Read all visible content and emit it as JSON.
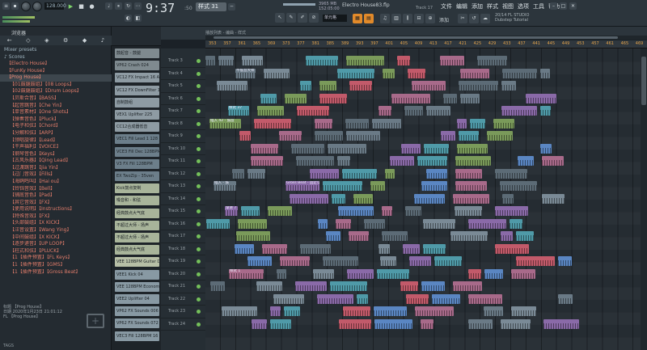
{
  "toolbar": {
    "bpm": "128.000",
    "time": "9:37",
    "time_sub": ":50",
    "pattern": "样式 31",
    "cpu": "3965 MB",
    "mem": "152:05:00",
    "song_title": "Electro House83.flp",
    "track_hint": "Track 17",
    "snap": "单元格",
    "add_label": "添加",
    "studio_line1": "20/14 FL STUDIO",
    "studio_line2": "Dubstep Tutorial"
  },
  "menu": [
    "文件",
    "编辑",
    "添加",
    "样式",
    "视图",
    "选项",
    "工具",
    "帮助"
  ],
  "browser": {
    "title": "浏览器",
    "tabs": [
      "←",
      "◇",
      "◈",
      "⚙",
      "◆",
      "♪"
    ],
    "items": [
      {
        "label": "Mixer presets",
        "kind": "plain"
      },
      {
        "label": "♪ Scores",
        "kind": "plain"
      },
      {
        "label": "【Electro House】",
        "kind": "normal"
      },
      {
        "label": "【FunKy House】",
        "kind": "normal"
      },
      {
        "label": "【Prog House】",
        "kind": "sel"
      },
      {
        "label": "【01鼓腿鼓组】【08 Loops】",
        "kind": "normal"
      },
      {
        "label": "【02鼓腿鼓组】【Drum Loops】",
        "kind": "normal"
      },
      {
        "label": "【贝斯合音】【BASS】",
        "kind": "normal"
      },
      {
        "label": "【起音跳音】【Che Yin】",
        "kind": "normal"
      },
      {
        "label": "【单音素材】【One Shots】",
        "kind": "normal"
      },
      {
        "label": "【弹奏音色】【Pluck】",
        "kind": "normal"
      },
      {
        "label": "【电子和弦】【Chord】",
        "kind": "normal"
      },
      {
        "label": "【分解和弦】【ARP】",
        "kind": "normal"
      },
      {
        "label": "【领唱旋律】【Lead】",
        "kind": "normal"
      },
      {
        "label": "【干声福利】【VOICE】",
        "kind": "normal"
      },
      {
        "label": "【钢琴音色】【Keys】",
        "kind": "normal"
      },
      {
        "label": "【古风乐器】【Qing Lead】",
        "kind": "normal"
      },
      {
        "label": "【过渡跳音】【Jia Yin】",
        "kind": "normal"
      },
      {
        "label": "【过门音效】【Fills】",
        "kind": "normal"
      },
      {
        "label": "【海鸥鸣叫】【Hai ou】",
        "kind": "normal"
      },
      {
        "label": "【铃铛音效】【Bell】",
        "kind": "normal"
      },
      {
        "label": "【铺底音色】【Pad】",
        "kind": "normal"
      },
      {
        "label": "【其它音效】【FX】",
        "kind": "normal"
      },
      {
        "label": "【使用说明】【Instructions】",
        "kind": "normal"
      },
      {
        "label": "【特殊音效】【FX】",
        "kind": "normal"
      },
      {
        "label": "【头部鼓组】【X KICK】",
        "kind": "normal"
      },
      {
        "label": "【汪音设置】【Wang Ying】",
        "kind": "normal"
      },
      {
        "label": "【中间鼓组】【X KICK】",
        "kind": "normal"
      },
      {
        "label": "【逐步递音】【UP LOOP】",
        "kind": "normal"
      },
      {
        "label": "【柱式和弦】【PLUCK】",
        "kind": "normal"
      },
      {
        "label": "【1【插件预置】【FL Keys】",
        "kind": "normal"
      },
      {
        "label": "【1【插件预置】【GMS】",
        "kind": "normal"
      },
      {
        "label": "【1【插件预置】【Gross Beat】",
        "kind": "normal"
      }
    ],
    "foot_lines": [
      "标题   【Prog House】",
      "日期   2020年1月23日 21:01:12",
      "FL 【Prog House】"
    ],
    "tags_label": "TAGS"
  },
  "patterns": [
    {
      "label": "鼓起音 - 鼓腿",
      "color": "#7f8a8f"
    },
    {
      "label": "VP62 Crash 024",
      "color": "#7f8a8f"
    },
    {
      "label": "VC12 FX Impact 16 Ac",
      "color": "#8e9ba3"
    },
    {
      "label": "VC12 FX DownFilter 100",
      "color": "#8e9ba3"
    },
    {
      "label": "自制鼓组",
      "color": "#8e9ba3"
    },
    {
      "label": "VEX1 Uplifter 225",
      "color": "#8e9ba3"
    },
    {
      "label": "CC12合成器低音",
      "color": "#8e9ba3"
    },
    {
      "label": "VEC1 Fill Lead 1 128",
      "color": "#6c7e8a"
    },
    {
      "label": "VCE3 Fill Dec 128BPM",
      "color": "#6c7e8a"
    },
    {
      "label": "V3 FX Fill 128BPM",
      "color": "#6c7e8a"
    },
    {
      "label": "EX TwoZip - 35ven",
      "color": "#6c7e8a"
    },
    {
      "label": "Kick鼓点复制",
      "color": "#a8b49a"
    },
    {
      "label": "嗓音和 - 和弦",
      "color": "#a8b49a"
    },
    {
      "label": "经典鼓点大气底",
      "color": "#a8b49a"
    },
    {
      "label": "不超过大师 - 扬声",
      "color": "#a8b49a"
    },
    {
      "label": "不超过大师 - 扬声",
      "color": "#a8b49a"
    },
    {
      "label": "经典鼓点大气底",
      "color": "#a8b49a"
    },
    {
      "label": "VEE 128BPM Guitar Drum",
      "color": "#b7bfa6"
    },
    {
      "label": "VEE1 Kick 04",
      "color": "#8899a3"
    },
    {
      "label": "VEE 128BPM Economy Dr",
      "color": "#8899a3"
    },
    {
      "label": "VEE2 Uplifter 04",
      "color": "#8899a3"
    },
    {
      "label": "VP62 FX Sounds 006",
      "color": "#8899a3"
    },
    {
      "label": "VP62 FX Sounds 072",
      "color": "#8899a3"
    },
    {
      "label": "VEC3 Fill 128BPM 16",
      "color": "#8899a3"
    }
  ],
  "playlist": {
    "path": "播放列表 - 编曲 - 样式",
    "ruler": [
      "353",
      "357",
      "361",
      "365",
      "369",
      "373",
      "377",
      "381",
      "385",
      "389",
      "393",
      "397",
      "401",
      "405",
      "409",
      "413",
      "417",
      "421",
      "425",
      "429",
      "433",
      "437",
      "441",
      "445",
      "449",
      "453",
      "457",
      "461",
      "465",
      "469"
    ],
    "tracks": [
      "Track 3",
      "Track 4",
      "Track 5",
      "Track 6",
      "Track 7",
      "Track 8",
      "Track 9",
      "Track 10",
      "Track 11",
      "Track 12",
      "Track 13",
      "Track 14",
      "Track 15",
      "Track 16",
      "Track 17",
      "Track 18",
      "Track 19",
      "Track 20",
      "Track 21",
      "Track 22",
      "Track 23",
      "Track 24"
    ],
    "clip_labels": {
      "t4": "不低音大师 - 干声",
      "t7": "样式 37",
      "t8": "插入 42 - 鼓层",
      "t13": "插入 - 鼓",
      "t13b": "Gross Beat - 固定电平",
      "t14": "样式 34",
      "t15": "渐进 7 - 鼓",
      "t20": "样式 1"
    }
  }
}
